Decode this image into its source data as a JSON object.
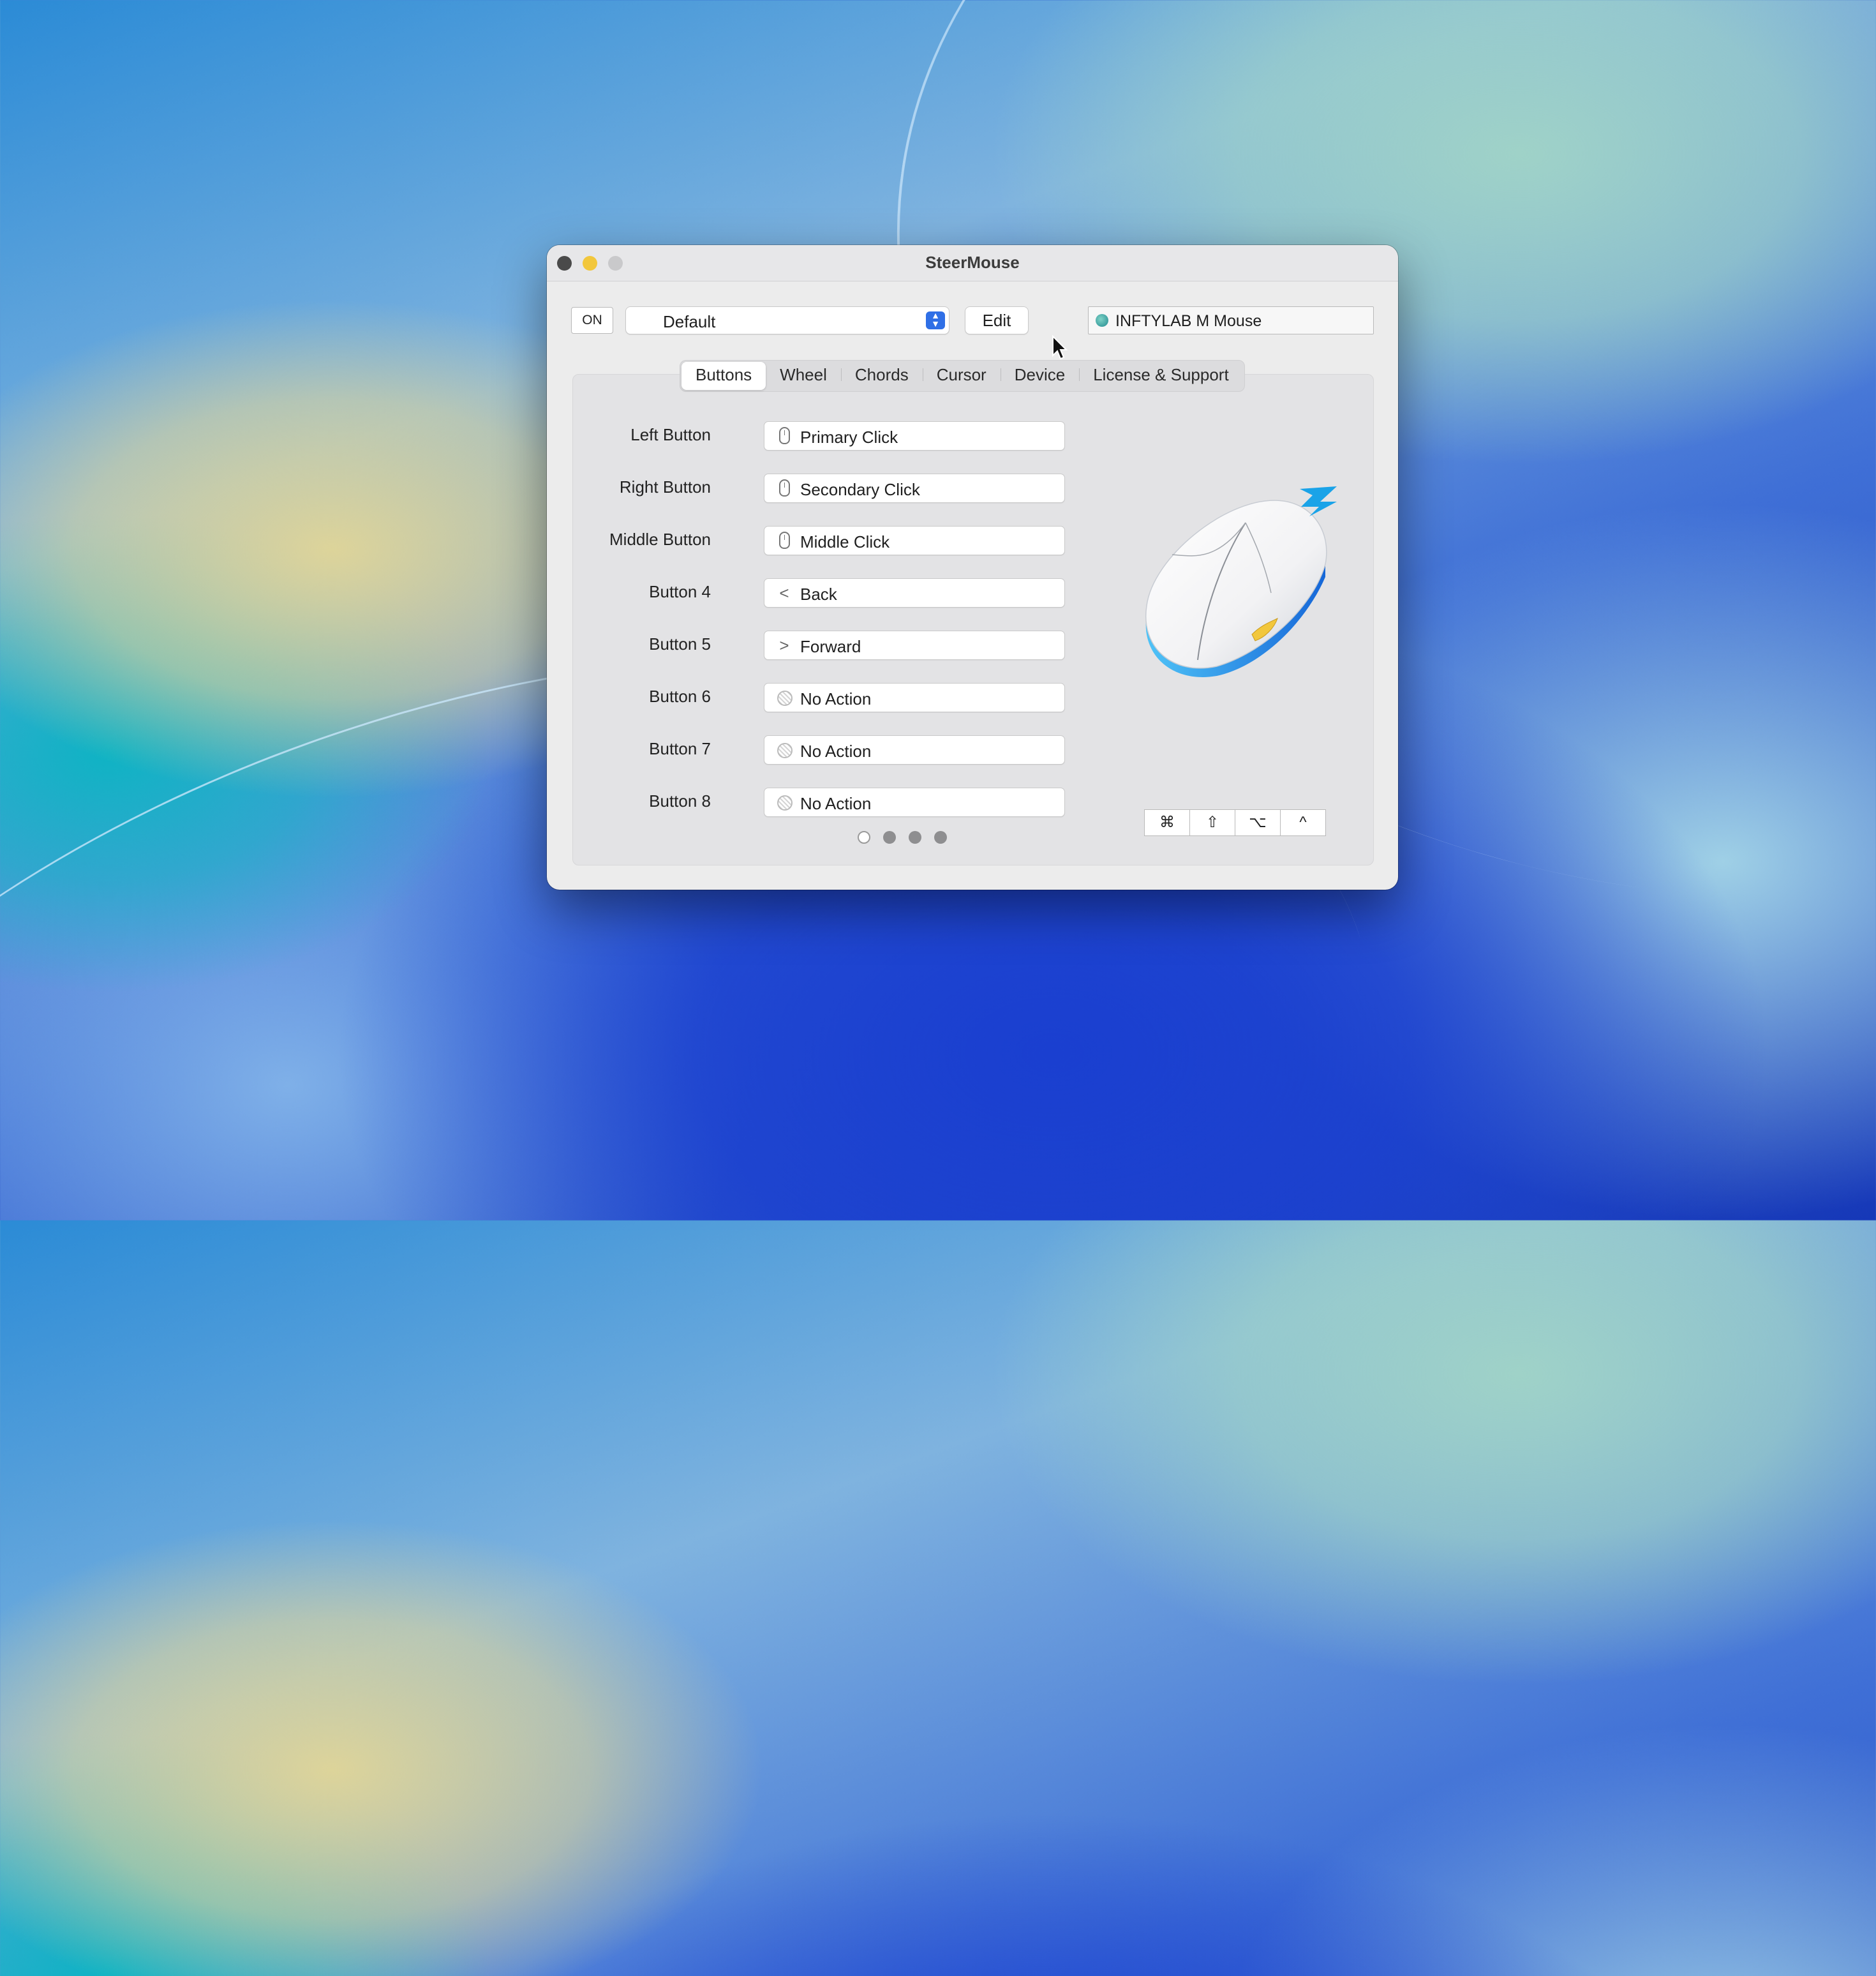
{
  "window": {
    "title": "SteerMouse"
  },
  "toolbar": {
    "on_label": "ON",
    "preset": "Default",
    "edit_label": "Edit",
    "device": "INFTYLAB M Mouse"
  },
  "tabs": [
    "Buttons",
    "Wheel",
    "Chords",
    "Cursor",
    "Device",
    "License & Support"
  ],
  "active_tab": "Buttons",
  "buttons": [
    {
      "label": "Left Button",
      "action": "Primary Click",
      "icon": "mouse-icon"
    },
    {
      "label": "Right Button",
      "action": "Secondary Click",
      "icon": "mouse-icon"
    },
    {
      "label": "Middle Button",
      "action": "Middle Click",
      "icon": "mouse-icon"
    },
    {
      "label": "Button 4",
      "action": "Back",
      "icon": "chevron-left-icon"
    },
    {
      "label": "Button 5",
      "action": "Forward",
      "icon": "chevron-right-icon"
    },
    {
      "label": "Button 6",
      "action": "No Action",
      "icon": "no-action-icon"
    },
    {
      "label": "Button 7",
      "action": "No Action",
      "icon": "no-action-icon"
    },
    {
      "label": "Button 8",
      "action": "No Action",
      "icon": "no-action-icon"
    }
  ],
  "pager": {
    "pages": 4,
    "current": 1
  },
  "modifiers": [
    "⌘",
    "⇧",
    "⌥",
    "^"
  ],
  "colors": {
    "accent": "#2f6fe6",
    "mouse_accent": "#1aa3e8",
    "mouse_button": "#f2c73c"
  }
}
